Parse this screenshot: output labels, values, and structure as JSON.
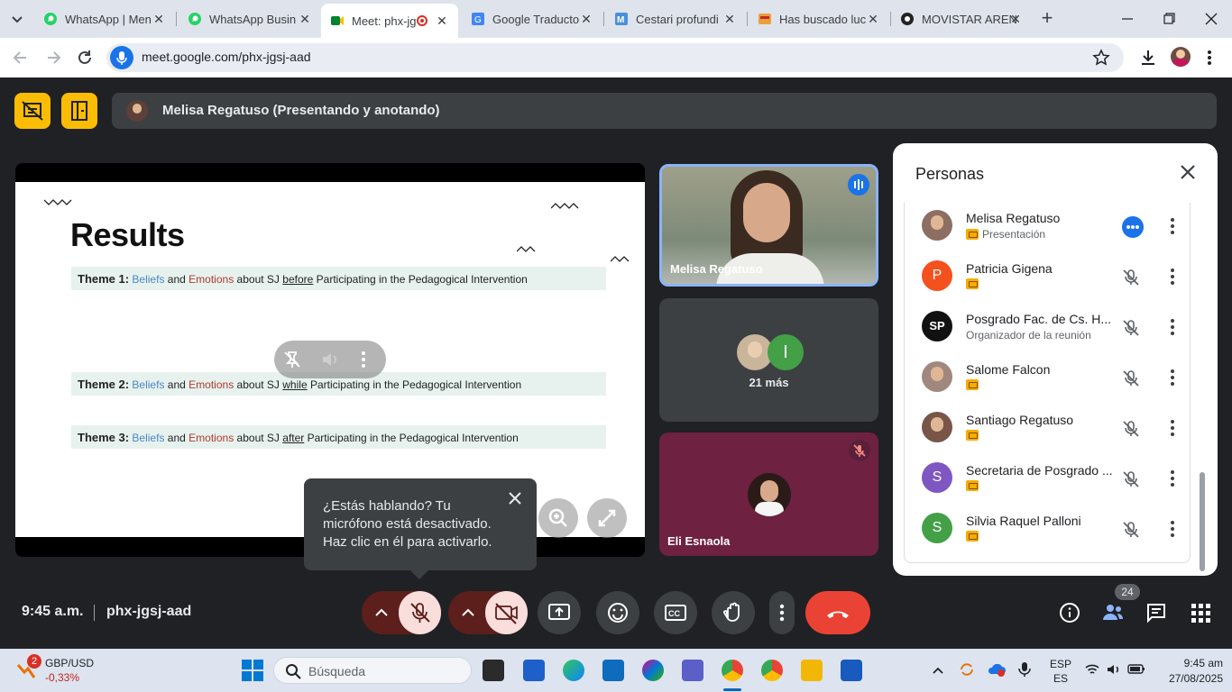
{
  "browser": {
    "tabs": [
      {
        "label": "WhatsApp | Men",
        "icon": "whatsapp-icon",
        "color": "#25d366"
      },
      {
        "label": "WhatsApp Busin",
        "icon": "whatsapp-icon",
        "color": "#25d366"
      },
      {
        "label": "Meet: phx-jg",
        "icon": "meet-icon",
        "color": "#00832d",
        "active": true
      },
      {
        "label": "Google Traducto",
        "icon": "translate-icon",
        "color": "#4285f4"
      },
      {
        "label": "Cestari profundi",
        "icon": "m-icon",
        "color": "#4a90d9"
      },
      {
        "label": "Has buscado luc",
        "icon": "store-icon",
        "color": "#e8a13a"
      },
      {
        "label": "MOVISTAR AREN",
        "icon": "movistar-icon",
        "color": "#222222"
      }
    ],
    "url": "meet.google.com/phx-jgsj-aad"
  },
  "meet": {
    "presenter_label": "Melisa Regatuso (Presentando y anotando)",
    "slide": {
      "title": "Results",
      "themes": [
        {
          "label": "Theme 1:",
          "w1": "Beliefs",
          "and": "and",
          "w2": "Emotions",
          "about": "about SJ",
          "when": "before",
          "rest": "Participating in the Pedagogical Intervention"
        },
        {
          "label": "Theme 2:",
          "w1": "Beliefs",
          "and": "and",
          "w2": "Emotions",
          "about": "about SJ",
          "when": "while",
          "rest": "Participating in the Pedagogical Intervention"
        },
        {
          "label": "Theme 3:",
          "w1": "Beliefs",
          "and": "and",
          "w2": "Emotions",
          "about": "about SJ",
          "when": "after",
          "rest": "Participating in the Pedagogical Intervention"
        }
      ]
    },
    "tooltip": "¿Estás hablando? Tu micrófono está desactivado. Haz clic en él para activarlo.",
    "tiles": {
      "speaker_name": "Melisa Regatuso",
      "more_label": "21 más",
      "more_initial": "I",
      "eli_name": "Eli Esnaola"
    },
    "people_panel": {
      "title": "Personas",
      "people": [
        {
          "name": "Melisa Regatuso",
          "sub": "Presentación",
          "initial": "",
          "color": "#8d6e63",
          "presenting": true
        },
        {
          "name": "Patricia Gigena",
          "sub": "",
          "initial": "P",
          "color": "#f4511e"
        },
        {
          "name": "Posgrado Fac. de Cs. H...",
          "sub": "Organizador de la reunión",
          "initial": "SP",
          "color": "#111111"
        },
        {
          "name": "Salome Falcon",
          "sub": "",
          "initial": "",
          "color": "#a1887f"
        },
        {
          "name": "Santiago Regatuso",
          "sub": "",
          "initial": "",
          "color": "#795548"
        },
        {
          "name": "Secretaria de Posgrado ...",
          "sub": "",
          "initial": "S",
          "color": "#7e57c2"
        },
        {
          "name": "Silvia Raquel Palloni",
          "sub": "",
          "initial": "S",
          "color": "#43a047"
        }
      ]
    },
    "bottom": {
      "time": "9:45 a.m.",
      "code": "phx-jgsj-aad",
      "participant_count": "24"
    }
  },
  "taskbar": {
    "widget_badge": "2",
    "widget_title": "GBP/USD",
    "widget_value": "-0,33%",
    "search_placeholder": "Búsqueda",
    "lang_top": "ESP",
    "lang_bottom": "ES",
    "time": "9:45 am",
    "date": "27/08/2025"
  }
}
